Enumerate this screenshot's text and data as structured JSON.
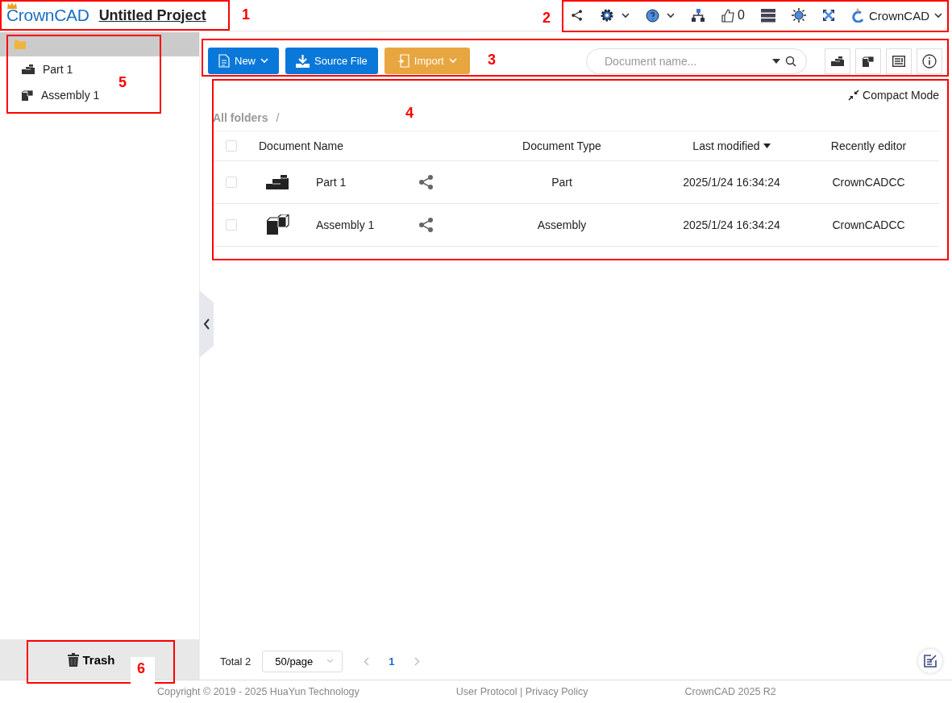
{
  "header": {
    "logo": "CrownCAD",
    "project_title": "Untitled Project",
    "likes": "0",
    "user": "CrownCAD"
  },
  "sidebar": {
    "items": [
      {
        "kind": "part",
        "label": "Part 1"
      },
      {
        "kind": "assembly",
        "label": "Assembly 1"
      }
    ],
    "trash": "Trash"
  },
  "toolbar": {
    "buttons": [
      {
        "kind": "new",
        "label": "New"
      },
      {
        "kind": "download",
        "label": "Source File"
      },
      {
        "kind": "import",
        "label": "Import"
      }
    ],
    "search": {
      "placeholder": "Document name..."
    }
  },
  "compact_mode": "Compact Mode",
  "breadcrumb": {
    "folder": "All folders",
    "separator": "/"
  },
  "table": {
    "select_all_checked": false,
    "columns": [
      "Document Name",
      "Document Type",
      "Last modified",
      "Recently editor"
    ],
    "rows": [
      {
        "kind": "part",
        "checked": false,
        "name": "Part 1",
        "type": "Part",
        "modified": "2025/1/24 16:34:24",
        "editor": "CrownCADCC"
      },
      {
        "kind": "assembly",
        "checked": false,
        "name": "Assembly 1",
        "type": "Assembly",
        "modified": "2025/1/24 16:34:24",
        "editor": "CrownCADCC"
      }
    ]
  },
  "pagination": {
    "total": "Total 2",
    "page_size": "50/page",
    "pages": [
      {
        "label": "1",
        "selected": true
      }
    ]
  },
  "footer": {
    "copyright": "Copyright © 2019 - 2025 HuaYun Technology",
    "links": "User Protocol | Privacy Policy",
    "version": "CrownCAD 2025 R2"
  },
  "annotations": [
    {
      "label": "1"
    },
    {
      "label": "2"
    },
    {
      "label": "3"
    },
    {
      "label": "4"
    },
    {
      "label": "5"
    },
    {
      "label": "6"
    }
  ]
}
